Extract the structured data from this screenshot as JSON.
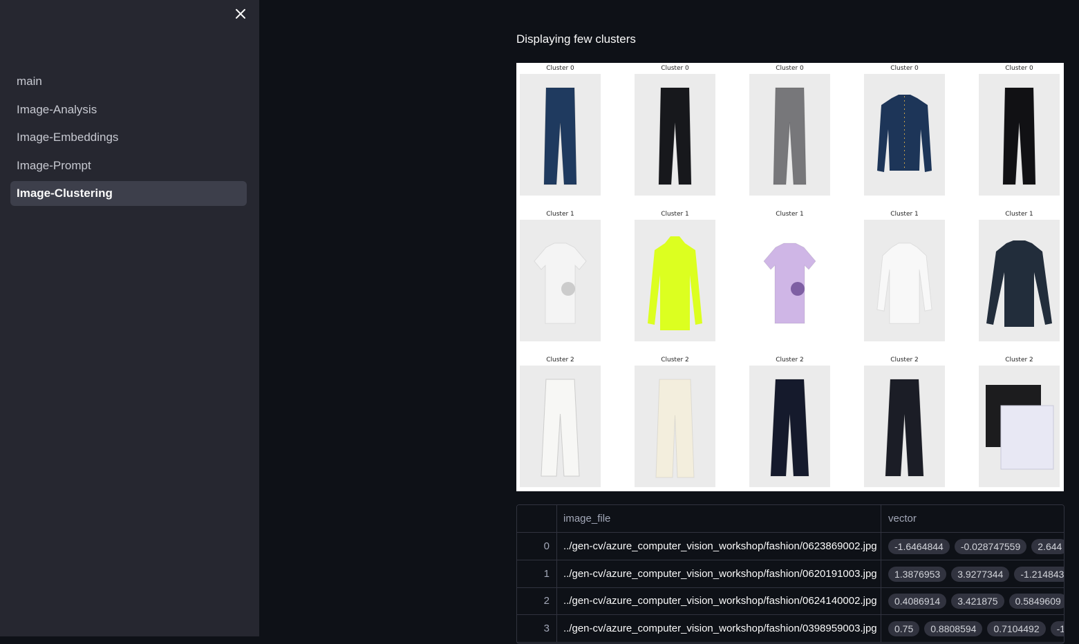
{
  "sidebar": {
    "nav": [
      {
        "label": "main",
        "active": false
      },
      {
        "label": "Image-Analysis",
        "active": false
      },
      {
        "label": "Image-Embeddings",
        "active": false
      },
      {
        "label": "Image-Prompt",
        "active": false
      },
      {
        "label": "Image-Clustering",
        "active": true
      }
    ]
  },
  "main": {
    "title": "Displaying few clusters"
  },
  "figure": {
    "rows": [
      {
        "caption": "Cluster 0",
        "items": [
          "jeans-blue",
          "jeans-black",
          "jeans-grey",
          "denim-jacket",
          "jeans-black-slim"
        ]
      },
      {
        "caption": "Cluster 1",
        "items": [
          "tshirt-white-print",
          "hoodie-neon",
          "tshirt-lilac-print",
          "top-white",
          "longsleeve-navy"
        ]
      },
      {
        "caption": "Cluster 2",
        "items": [
          "trousers-white",
          "trousers-cream",
          "trousers-navy",
          "trousers-black",
          "laundry-bags"
        ]
      }
    ]
  },
  "dataframe": {
    "columns": [
      "",
      "image_file",
      "vector"
    ],
    "rows": [
      {
        "index": "0",
        "image_file": "../gen-cv/azure_computer_vision_workshop/fashion/0623869002.jpg",
        "vector": [
          "-1.6464844",
          "-0.028747559",
          "2.644"
        ]
      },
      {
        "index": "1",
        "image_file": "../gen-cv/azure_computer_vision_workshop/fashion/0620191003.jpg",
        "vector": [
          "1.3876953",
          "3.9277344",
          "-1.214843"
        ]
      },
      {
        "index": "2",
        "image_file": "../gen-cv/azure_computer_vision_workshop/fashion/0624140002.jpg",
        "vector": [
          "0.4086914",
          "3.421875",
          "0.5849609"
        ]
      },
      {
        "index": "3",
        "image_file": "../gen-cv/azure_computer_vision_workshop/fashion/0398959003.jpg",
        "vector": [
          "0.75",
          "0.8808594",
          "0.7104492",
          "-1"
        ]
      }
    ]
  }
}
